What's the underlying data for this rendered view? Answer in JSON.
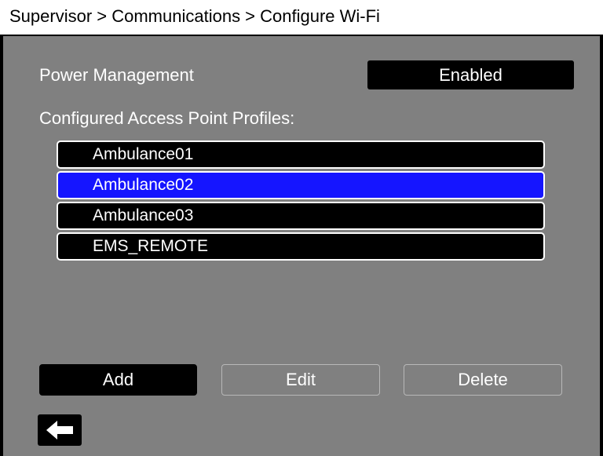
{
  "title": "Supervisor > Communications > Configure Wi-Fi",
  "power_management": {
    "label": "Power Management",
    "value": "Enabled"
  },
  "profiles": {
    "label": "Configured Access Point Profiles:",
    "items": [
      {
        "name": "Ambulance01",
        "selected": false
      },
      {
        "name": "Ambulance02",
        "selected": true
      },
      {
        "name": "Ambulance03",
        "selected": false
      },
      {
        "name": "EMS_REMOTE",
        "selected": false
      }
    ]
  },
  "buttons": {
    "add": "Add",
    "edit": "Edit",
    "delete": "Delete",
    "back_icon": "back-arrow-icon"
  },
  "colors": {
    "background": "#808080",
    "selected_row": "#1515ff",
    "row": "#000000",
    "titlebar": "#ffffff"
  }
}
